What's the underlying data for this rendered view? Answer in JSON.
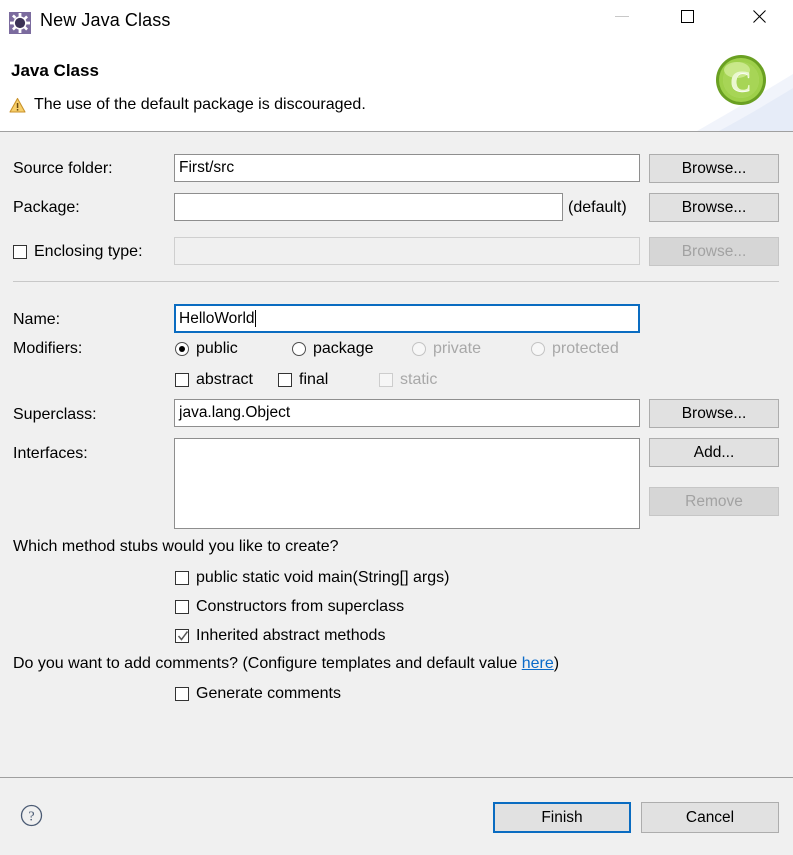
{
  "window": {
    "title": "New Java Class",
    "icon": "eclipse-wizard-icon",
    "controls": {
      "minimize": "minimize-icon",
      "maximize": "maximize-icon",
      "close": "close-icon"
    }
  },
  "banner": {
    "title": "Java Class",
    "warning_icon": "warning-triangle-icon",
    "warning_text": "The use of the default package is discouraged.",
    "art_icon": "java-class-green-c-icon"
  },
  "form": {
    "source_folder": {
      "label": "Source folder:",
      "value": "First/src",
      "placeholder": "",
      "browse_label": "Browse..."
    },
    "package": {
      "label": "Package:",
      "value": "",
      "placeholder": "",
      "suffix": "(default)",
      "browse_label": "Browse..."
    },
    "enclosing_type": {
      "label": "Enclosing type:",
      "checked": false,
      "value": "",
      "placeholder": "",
      "browse_label": "Browse...",
      "disabled": true
    },
    "name": {
      "label": "Name:",
      "value": "HelloWorld",
      "placeholder": "",
      "focused": true
    },
    "modifiers": {
      "label": "Modifiers:",
      "access": [
        {
          "label": "public",
          "checked": true,
          "disabled": false
        },
        {
          "label": "package",
          "checked": false,
          "disabled": false
        },
        {
          "label": "private",
          "checked": false,
          "disabled": true
        },
        {
          "label": "protected",
          "checked": false,
          "disabled": true
        }
      ],
      "flags": [
        {
          "label": "abstract",
          "checked": false,
          "disabled": false
        },
        {
          "label": "final",
          "checked": false,
          "disabled": false
        },
        {
          "label": "static",
          "checked": false,
          "disabled": true
        }
      ]
    },
    "superclass": {
      "label": "Superclass:",
      "value": "java.lang.Object",
      "placeholder": "",
      "browse_label": "Browse..."
    },
    "interfaces": {
      "label": "Interfaces:",
      "items": [],
      "add_label": "Add...",
      "remove_label": "Remove",
      "remove_disabled": true
    }
  },
  "stubs": {
    "question": "Which method stubs would you like to create?",
    "options": [
      {
        "label": "public static void main(String[] args)",
        "checked": false
      },
      {
        "label": "Constructors from superclass",
        "checked": false
      },
      {
        "label": "Inherited abstract methods",
        "checked": true
      }
    ]
  },
  "comments": {
    "question_prefix": "Do you want to add comments? (Configure templates and default value ",
    "link_label": "here",
    "question_suffix": ")",
    "option": {
      "label": "Generate comments",
      "checked": false
    }
  },
  "footer": {
    "help_icon": "help-question-icon",
    "finish_label": "Finish",
    "cancel_label": "Cancel"
  },
  "colors": {
    "dialog_bg": "#f0f0f0",
    "header_bg": "#ffffff",
    "focus_blue": "#0a6cc1",
    "link_blue": "#0a6ac9",
    "warning_amber": "#f0ad33",
    "class_green": "#8cc63e",
    "disabled_text": "#a0a0a0"
  }
}
